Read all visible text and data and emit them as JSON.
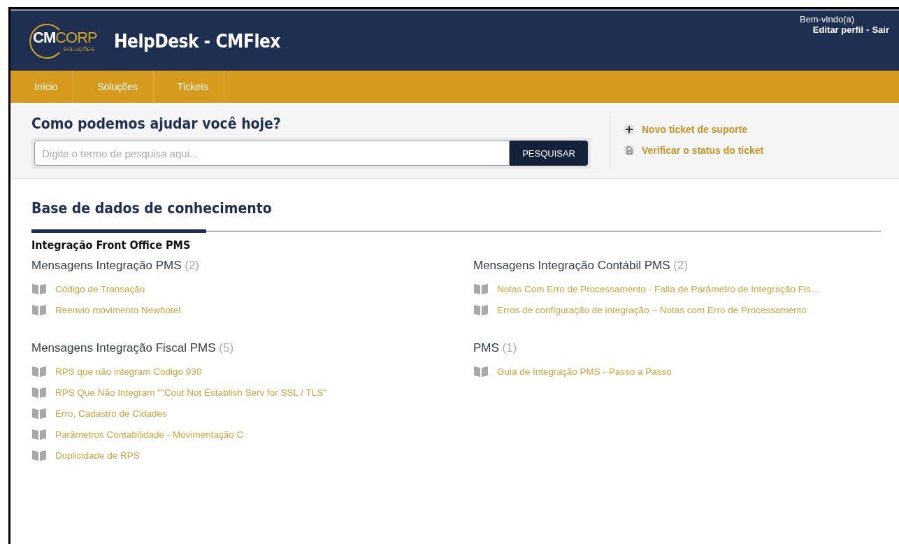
{
  "header": {
    "logo": {
      "part_1": "CM",
      "part_2": "CORP",
      "tagline": "SOLUÇÕES"
    },
    "title": "HelpDesk - CMFlex",
    "welcome": "Bem-vindo(a)",
    "profile_links": [
      {
        "label": "Editar perfil"
      },
      {
        "label": "Sair"
      }
    ],
    "separator": "-"
  },
  "nav": {
    "items": [
      {
        "label": "Início",
        "selected": false
      },
      {
        "label": "Soluções",
        "selected": false
      },
      {
        "label": "Tickets",
        "selected": false
      }
    ]
  },
  "search": {
    "heading": "Como podemos ajudar você hoje?",
    "placeholder": "Digite o termo de pesquisa aqui...",
    "button": "PESQUISAR"
  },
  "actions": [
    {
      "kind": "plus",
      "label": "Novo ticket de suporte"
    },
    {
      "kind": "document",
      "label": "Verificar o status do ticket"
    }
  ],
  "knowledge_base": {
    "title": "Base de dados de conhecimento",
    "section": "Integração Front Office PMS",
    "categories": [
      {
        "name": "Mensagens Integração PMS",
        "count": "(2)",
        "articles": [
          "Código de Transação",
          "Reenvio movimento Newhotel"
        ]
      },
      {
        "name": "Mensagens Integração Contábil PMS",
        "count": "(2)",
        "articles": [
          "Notas Com Erro de Processamento - Falta de Parâmetro de Integração Fis...",
          "Erros de configuração de integração – Notas com Erro de Processamento"
        ]
      },
      {
        "name": "Mensagens Integração Fiscal PMS",
        "count": "(5)",
        "articles": [
          "RPS que não integram Codigo 930",
          "RPS Que Não Integram \"\"Cout Not Establish Serv for SSL / TLS\"",
          "Erro, Cadastro de Cidades",
          "Parâmetros Contabilidade - Movimentação C",
          "Duplicidade de RPS"
        ]
      },
      {
        "name": "PMS",
        "count": "(1)",
        "articles": [
          "Guia de Integração PMS - Passo a Passo"
        ]
      }
    ]
  }
}
